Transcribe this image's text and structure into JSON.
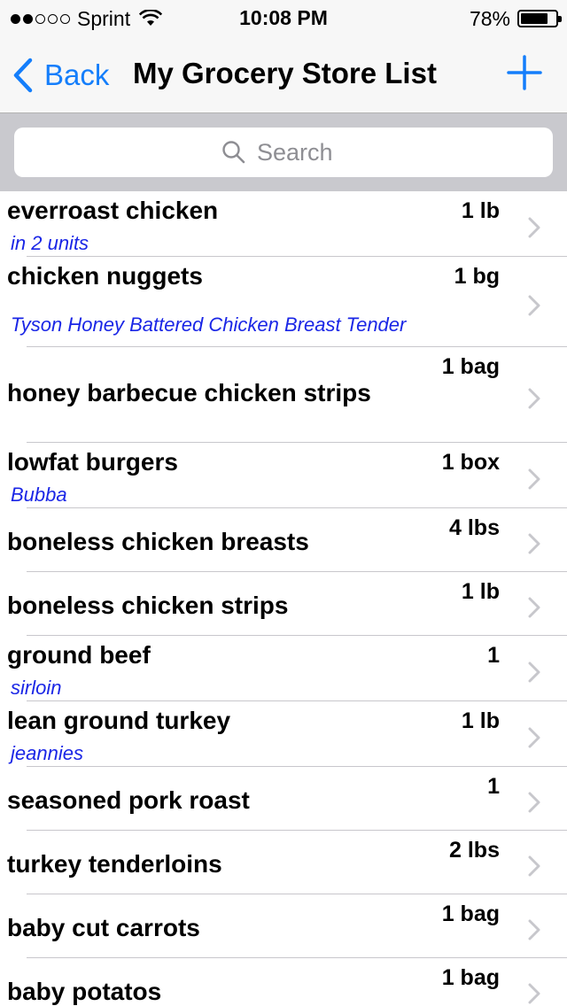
{
  "status_bar": {
    "carrier": "Sprint",
    "signal_strength": 2,
    "signal_max": 5,
    "time": "10:08 PM",
    "battery_text": "78%",
    "battery_level": 0.78,
    "icons": [
      "signal-dots-icon",
      "wifi-icon",
      "battery-icon"
    ]
  },
  "nav": {
    "back_label": "Back",
    "title": "My Grocery Store List",
    "icons": [
      "back-chevron-icon",
      "plus-icon"
    ],
    "accent_color": "#147efb"
  },
  "search": {
    "placeholder": "Search",
    "icon": "search-icon"
  },
  "items": [
    {
      "name": "everroast chicken",
      "qty": "1 lb",
      "note": "in 2 units"
    },
    {
      "name": "chicken nuggets",
      "qty": "1 bg",
      "note": "Tyson Honey Battered Chicken Breast Tender"
    },
    {
      "name": "honey barbecue chicken strips",
      "qty": "1 bag",
      "note": ""
    },
    {
      "name": "lowfat burgers",
      "qty": "1 box",
      "note": "Bubba"
    },
    {
      "name": "boneless chicken breasts",
      "qty": "4 lbs",
      "note": ""
    },
    {
      "name": "boneless chicken strips",
      "qty": "1 lb",
      "note": ""
    },
    {
      "name": "ground beef",
      "qty": "1",
      "note": "sirloin"
    },
    {
      "name": "lean ground turkey",
      "qty": "1 lb",
      "note": "jeannies"
    },
    {
      "name": "seasoned pork roast",
      "qty": "1",
      "note": ""
    },
    {
      "name": "turkey tenderloins",
      "qty": "2 lbs",
      "note": ""
    },
    {
      "name": "baby cut carrots",
      "qty": "1 bag",
      "note": ""
    },
    {
      "name": "baby potatos",
      "qty": "1 bag",
      "note": ""
    }
  ],
  "colors": {
    "note_text": "#1a26e6",
    "chevron": "#c7c7cc",
    "separator": "#c8c7cc",
    "search_bar_bg": "#c9c9ce"
  }
}
